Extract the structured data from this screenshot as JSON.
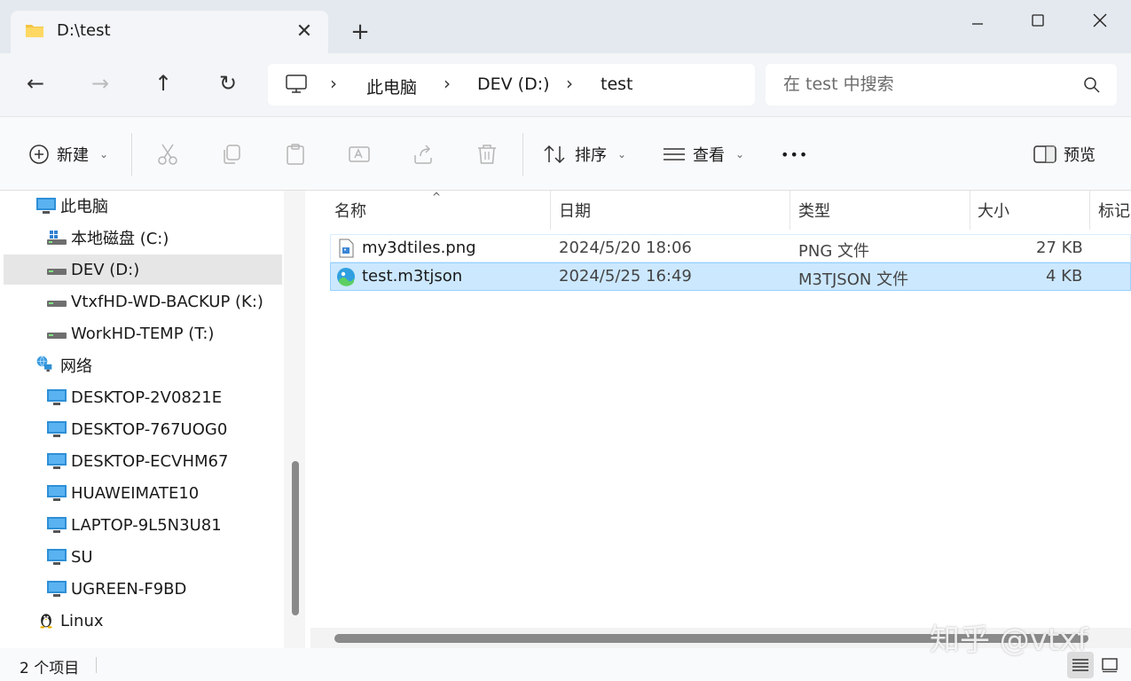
{
  "tab": {
    "title": "D:\\test",
    "close": "✕",
    "new_tab": "+"
  },
  "window": {
    "minimize": "—",
    "maximize": "☐",
    "close": "✕"
  },
  "nav": {
    "back": "←",
    "forward": "→",
    "up": "↑",
    "refresh": "↻"
  },
  "breadcrumb": {
    "items": [
      "此电脑",
      "DEV (D:)",
      "test"
    ],
    "sep": "›"
  },
  "search": {
    "placeholder": "在 test 中搜索"
  },
  "toolbar": {
    "new_label": "新建",
    "sort_label": "排序",
    "view_label": "查看",
    "more_label": "•••",
    "preview_label": "预览",
    "chevron": "⌄"
  },
  "sidebar": {
    "items": [
      {
        "label": "此电脑",
        "icon": "pc-icon"
      },
      {
        "label": "本地磁盘 (C:)",
        "icon": "drive-c-icon"
      },
      {
        "label": "DEV (D:)",
        "icon": "drive-icon"
      },
      {
        "label": "VtxfHD-WD-BACKUP (K:)",
        "icon": "drive-icon"
      },
      {
        "label": "WorkHD-TEMP (T:)",
        "icon": "drive-icon"
      },
      {
        "label": "网络",
        "icon": "network-icon"
      },
      {
        "label": "DESKTOP-2V0821E",
        "icon": "computer-icon"
      },
      {
        "label": "DESKTOP-767UOG0",
        "icon": "computer-icon"
      },
      {
        "label": "DESKTOP-ECVHM67",
        "icon": "computer-icon"
      },
      {
        "label": "HUAWEIMATE10",
        "icon": "computer-icon"
      },
      {
        "label": "LAPTOP-9L5N3U81",
        "icon": "computer-icon"
      },
      {
        "label": "SU",
        "icon": "computer-icon"
      },
      {
        "label": "UGREEN-F9BD",
        "icon": "computer-icon"
      },
      {
        "label": "Linux",
        "icon": "linux-icon"
      }
    ]
  },
  "columns": {
    "name": "名称",
    "date": "日期",
    "type": "类型",
    "size": "大小",
    "tags": "标记"
  },
  "files": [
    {
      "name": "my3dtiles.png",
      "date": "2024/5/20 18:06",
      "type": "PNG 文件",
      "size": "27 KB"
    },
    {
      "name": "test.m3tjson",
      "date": "2024/5/25 16:49",
      "type": "M3TJSON 文件",
      "size": "4 KB"
    }
  ],
  "status": {
    "count": "2 个项目"
  },
  "watermark": "知乎 @vtxf",
  "colors": {
    "accent": "#0067c0",
    "selection": "#cce8ff",
    "folder": "#f5c342"
  }
}
